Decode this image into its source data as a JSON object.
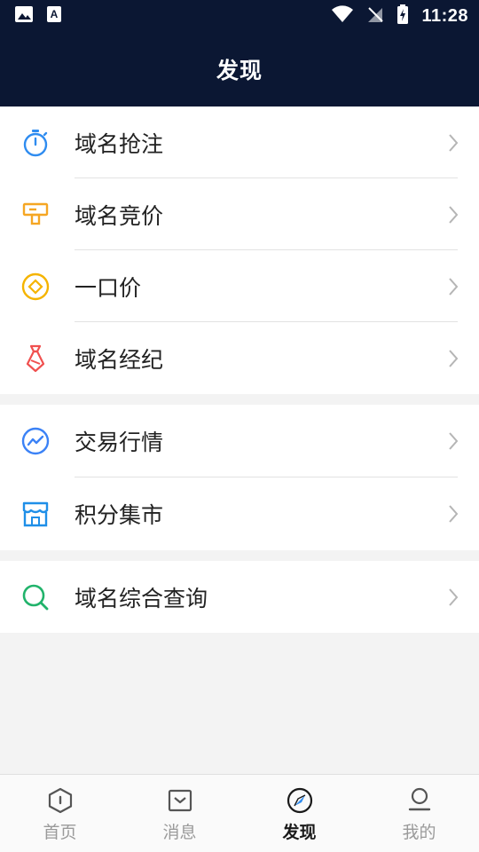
{
  "status_bar": {
    "time": "11:28"
  },
  "header": {
    "title": "发现"
  },
  "groups": [
    {
      "items": [
        {
          "label": "域名抢注",
          "icon": "stopwatch-icon",
          "color": "#2f8cf0"
        },
        {
          "label": "域名竞价",
          "icon": "auction-sign-icon",
          "color": "#f5a623"
        },
        {
          "label": "一口价",
          "icon": "diamond-coin-icon",
          "color": "#f5b400"
        },
        {
          "label": "域名经纪",
          "icon": "necktie-icon",
          "color": "#f0504f"
        }
      ]
    },
    {
      "items": [
        {
          "label": "交易行情",
          "icon": "trend-chart-icon",
          "color": "#3b82f6"
        },
        {
          "label": "积分集市",
          "icon": "storefront-icon",
          "color": "#1f8fe8"
        }
      ]
    },
    {
      "items": [
        {
          "label": "域名综合查询",
          "icon": "search-icon",
          "color": "#21b36b"
        }
      ]
    }
  ],
  "tabbar": {
    "tabs": [
      {
        "label": "首页",
        "icon": "home-hexagon-icon",
        "active": false
      },
      {
        "label": "消息",
        "icon": "message-box-icon",
        "active": false
      },
      {
        "label": "发现",
        "icon": "compass-icon",
        "active": true
      },
      {
        "label": "我的",
        "icon": "user-icon",
        "active": false
      }
    ]
  },
  "colors": {
    "header_bg": "#0b1733",
    "page_bg": "#f3f3f3",
    "active_tab_accent": "#2f8cf0"
  }
}
